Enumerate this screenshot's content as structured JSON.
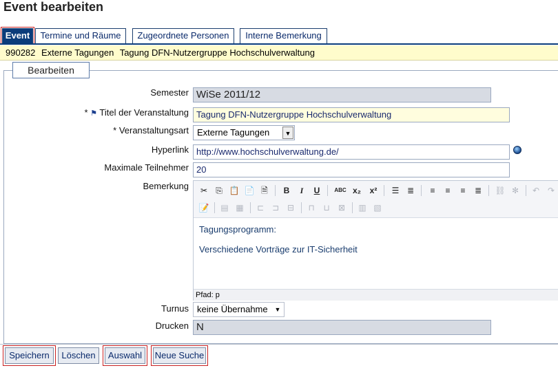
{
  "page": {
    "title": "Event bearbeiten"
  },
  "tabs": [
    {
      "label": "Event",
      "active": true
    },
    {
      "label": "Termine und Räume"
    },
    {
      "label": "Zugeordnete Personen"
    },
    {
      "label": "Interne Bemerkung"
    }
  ],
  "info": {
    "id": "990282",
    "type": "Externe Tagungen",
    "name": "Tagung DFN-Nutzergruppe Hochschulverwaltung"
  },
  "section": {
    "legend": "Bearbeiten"
  },
  "form": {
    "semester": {
      "label": "Semester",
      "value": "WiSe 2011/12"
    },
    "titel": {
      "label": "Titel der Veranstaltung",
      "required": "*",
      "value": "Tagung DFN-Nutzergruppe Hochschulverwaltung"
    },
    "art": {
      "label": "Veranstaltungsart",
      "required": "*",
      "value": "Externe Tagungen"
    },
    "hyperlink": {
      "label": "Hyperlink",
      "value": "http://www.hochschulverwaltung.de/"
    },
    "teilnehmer": {
      "label": "Maximale Teilnehmer",
      "value": "20"
    },
    "bemerkung": {
      "label": "Bemerkung",
      "lines": [
        "Tagungsprogramm:",
        "Verschiedene Vorträge zur IT-Sicherheit"
      ],
      "path": "Pfad: p"
    },
    "turnus": {
      "label": "Turnus",
      "value": "keine Übernahme"
    },
    "drucken": {
      "label": "Drucken",
      "value": "N"
    }
  },
  "toolbar": {
    "bold": "B",
    "italic": "I",
    "underline": "U",
    "spellcheck": "ABC",
    "subscript": "x₂",
    "superscript": "x²"
  },
  "buttons": {
    "save": "Speichern",
    "delete": "Löschen",
    "select": "Auswahl",
    "new_search": "Neue Suche"
  },
  "colors": {
    "accent": "#0b3c7a",
    "highlight": "#fffccc",
    "marker": "#c82020"
  }
}
